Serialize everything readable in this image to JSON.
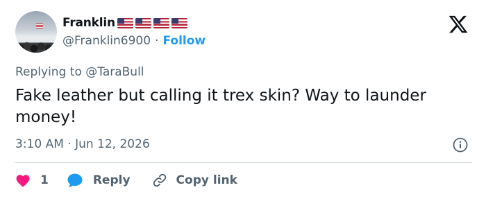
{
  "author": {
    "display_name": "Franklin",
    "flag_emojis": [
      "us-flag",
      "us-flag",
      "us-flag",
      "us-flag"
    ],
    "handle": "@Franklin6900",
    "separator": "·",
    "follow_label": "Follow"
  },
  "reply_context": {
    "prefix": "Replying to",
    "target": "@TaraBull"
  },
  "tweet": {
    "text": "Fake leather but calling it trex skin? Way to launder money!",
    "timestamp": "3:10 AM · Jun 12, 2026"
  },
  "actions": {
    "like_count": "1",
    "reply_label": "Reply",
    "copy_link_label": "Copy link"
  },
  "colors": {
    "accent": "#1d9bf0",
    "like": "#f91880",
    "muted": "#536471",
    "text": "#0f1419",
    "divider": "#cfd9de"
  },
  "icons": {
    "logo": "x-logo-icon",
    "info": "info-icon",
    "like": "heart-icon",
    "reply": "speech-bubble-icon",
    "copy": "link-icon"
  }
}
